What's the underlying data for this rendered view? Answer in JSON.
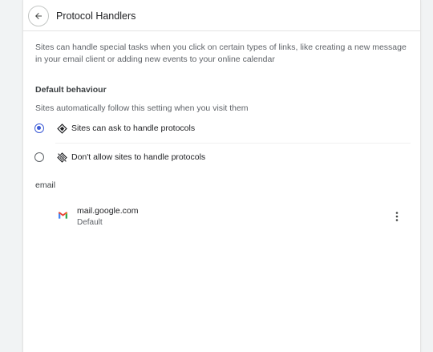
{
  "header": {
    "title": "Protocol Handlers",
    "back_icon": "arrow-back-icon"
  },
  "description": "Sites can handle special tasks when you click on certain types of links, like creating a new message in your email client or adding new events to your online calendar",
  "default_behaviour": {
    "title": "Default behaviour",
    "subtitle": "Sites automatically follow this setting when you visit them",
    "options": [
      {
        "label": "Sites can ask to handle protocols",
        "icon": "protocol-handler-icon",
        "selected": true
      },
      {
        "label": "Don't allow sites to handle protocols",
        "icon": "protocol-handler-off-icon",
        "selected": false
      }
    ]
  },
  "handlers": {
    "group_label": "email",
    "items": [
      {
        "site": "mail.google.com",
        "status": "Default",
        "icon": "gmail-icon"
      }
    ]
  },
  "colors": {
    "accent": "#3c5bd6",
    "text_secondary": "#5f6368"
  }
}
